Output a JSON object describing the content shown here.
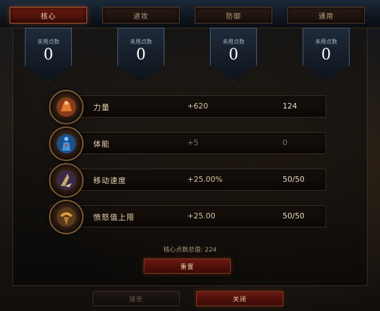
{
  "tabs": [
    {
      "label": "核心",
      "active": true
    },
    {
      "label": "进攻",
      "active": false
    },
    {
      "label": "防御",
      "active": false
    },
    {
      "label": "通用",
      "active": false
    }
  ],
  "unspent_points": [
    {
      "label": "未用点数",
      "value": "0"
    },
    {
      "label": "未用点数",
      "value": "0"
    },
    {
      "label": "未用点数",
      "value": "0"
    },
    {
      "label": "未用点数",
      "value": "0"
    }
  ],
  "stats": [
    {
      "name": "力量",
      "bonus": "+620",
      "value": "124",
      "icon": "strength-icon"
    },
    {
      "name": "体能",
      "bonus": "+5",
      "value": "0",
      "icon": "vitality-icon"
    },
    {
      "name": "移动速度",
      "bonus": "+25.00%",
      "value": "50/50",
      "icon": "movement-speed-icon"
    },
    {
      "name": "愤怒值上限",
      "bonus": "+25.00",
      "value": "50/50",
      "icon": "max-fury-icon"
    }
  ],
  "total_points": "核心点数总值: 224",
  "buttons": {
    "reset": "重置",
    "accept": "接受",
    "close": "关闭"
  },
  "colors": {
    "accent_red": "#6b1810",
    "gold_text": "#e6d2ad",
    "badge_blue": "#1f2b3a"
  }
}
